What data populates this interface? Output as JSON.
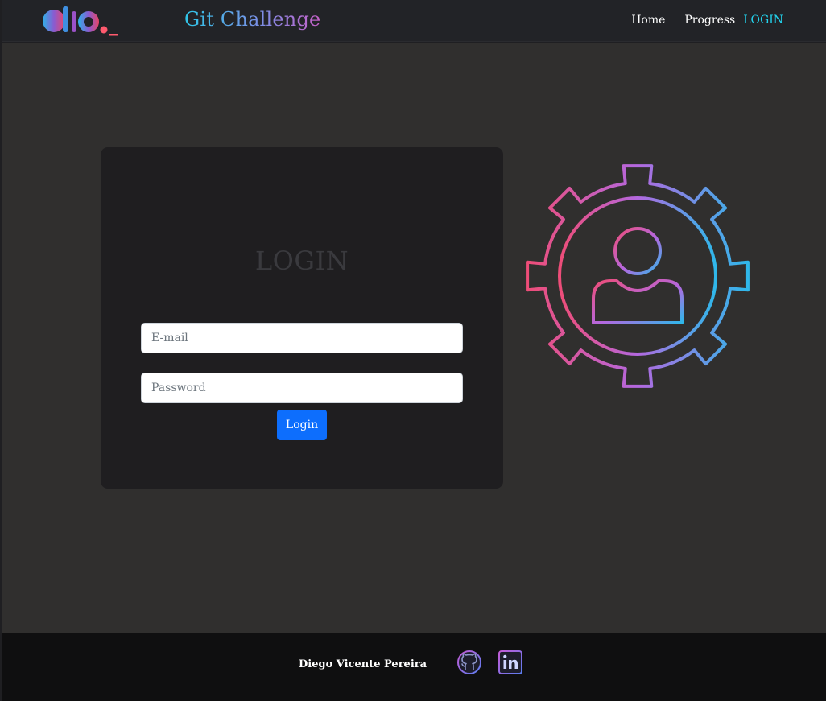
{
  "header": {
    "logo_text": "dio._",
    "title": "Git Challenge",
    "nav": [
      {
        "label": "Home"
      },
      {
        "label": "Progress"
      },
      {
        "label": "LOGIN"
      }
    ]
  },
  "login": {
    "heading": "LOGIN",
    "email_placeholder": "E-mail",
    "password_placeholder": "Password",
    "submit_label": "Login"
  },
  "illustration": {
    "icon": "user-gear-icon"
  },
  "footer": {
    "author": "Diego Vicente Pereira",
    "social": [
      {
        "icon": "github-icon"
      },
      {
        "icon": "linkedin-icon"
      }
    ]
  },
  "colors": {
    "accent": "#22d3ee",
    "primary_button": "#0d6efd",
    "gradient_start": "#ee4d78",
    "gradient_mid": "#b468e0",
    "gradient_end": "#2fb8ea"
  }
}
